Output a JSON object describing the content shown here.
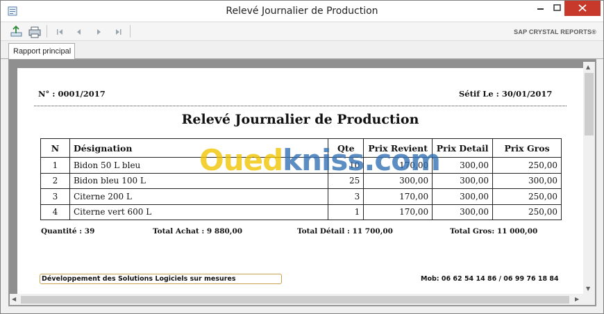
{
  "window": {
    "title": "Relevé Journalier de Production"
  },
  "toolbar": {
    "brand": "SAP CRYSTAL REPORTS®"
  },
  "tabs": [
    {
      "label": "Rapport principal"
    }
  ],
  "report": {
    "number": "N° : 0001/2017",
    "place_date": "Sétif Le :  30/01/2017",
    "title": "Relevé Journalier de Production",
    "columns": [
      "N",
      "Désignation",
      "Qte",
      "Prix Revient",
      "Prix Detail",
      "Prix Gros"
    ],
    "rows": [
      {
        "n": "1",
        "designation": "Bidon 50 L bleu",
        "qte": "10",
        "prix_revient": "170,00",
        "prix_detail": "300,00",
        "prix_gros": "250,00"
      },
      {
        "n": "2",
        "designation": "Bidon bleu 100 L",
        "qte": "25",
        "prix_revient": "300,00",
        "prix_detail": "300,00",
        "prix_gros": "300,00"
      },
      {
        "n": "3",
        "designation": "Citerne 200 L",
        "qte": "3",
        "prix_revient": "170,00",
        "prix_detail": "300,00",
        "prix_gros": "250,00"
      },
      {
        "n": "4",
        "designation": "Citerne vert 600 L",
        "qte": "1",
        "prix_revient": "170,00",
        "prix_detail": "300,00",
        "prix_gros": "250,00"
      }
    ],
    "totals": {
      "quantite": "Quantité : 39",
      "achat": "Total Achat :  9 880,00",
      "detail": "Total Détail :  11 700,00",
      "gros": "Total Gros:  11 000,00"
    },
    "footer_left": "Développement des Solutions Logiciels sur mesures",
    "footer_right": "Mob: 06 62 54 14 86 / 06 99 76 18 84"
  },
  "watermark": {
    "part1": "Oued",
    "part2": "kniss",
    "part3": ".com"
  },
  "colors": {
    "close_button": "#c7392b",
    "watermark_yellow": "#f2c300",
    "watermark_blue": "#2f6fb3"
  }
}
